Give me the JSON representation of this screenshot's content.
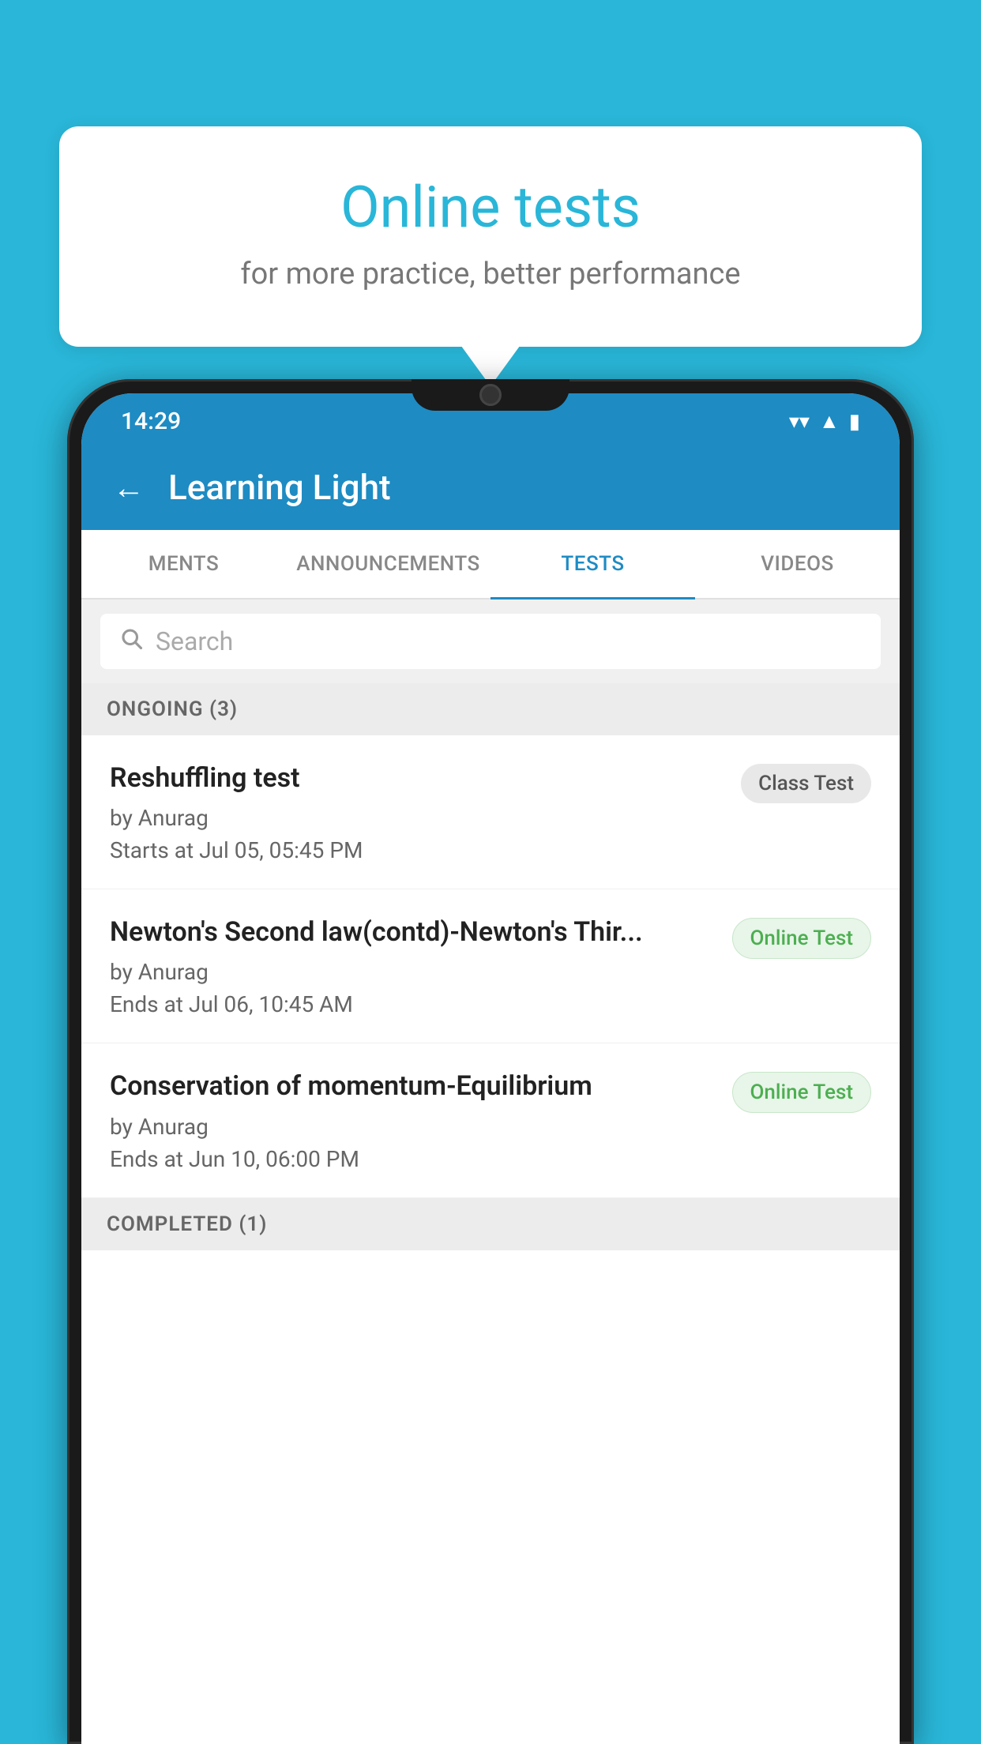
{
  "background_color": "#29b6d8",
  "speech_bubble": {
    "title": "Online tests",
    "subtitle": "for more practice, better performance"
  },
  "phone": {
    "status_bar": {
      "time": "14:29",
      "wifi": "▼",
      "signal": "▲",
      "battery": "▮"
    },
    "header": {
      "back_label": "←",
      "title": "Learning Light"
    },
    "tabs": [
      {
        "label": "MENTS",
        "active": false
      },
      {
        "label": "ANNOUNCEMENTS",
        "active": false
      },
      {
        "label": "TESTS",
        "active": true
      },
      {
        "label": "VIDEOS",
        "active": false
      }
    ],
    "search": {
      "placeholder": "Search"
    },
    "ongoing_section": {
      "header": "ONGOING (3)",
      "tests": [
        {
          "name": "Reshuffling test",
          "author": "by Anurag",
          "date": "Starts at  Jul 05, 05:45 PM",
          "badge": "Class Test",
          "badge_type": "class"
        },
        {
          "name": "Newton's Second law(contd)-Newton's Thir...",
          "author": "by Anurag",
          "date": "Ends at  Jul 06, 10:45 AM",
          "badge": "Online Test",
          "badge_type": "online"
        },
        {
          "name": "Conservation of momentum-Equilibrium",
          "author": "by Anurag",
          "date": "Ends at  Jun 10, 06:00 PM",
          "badge": "Online Test",
          "badge_type": "online"
        }
      ]
    },
    "completed_section": {
      "header": "COMPLETED (1)"
    }
  }
}
